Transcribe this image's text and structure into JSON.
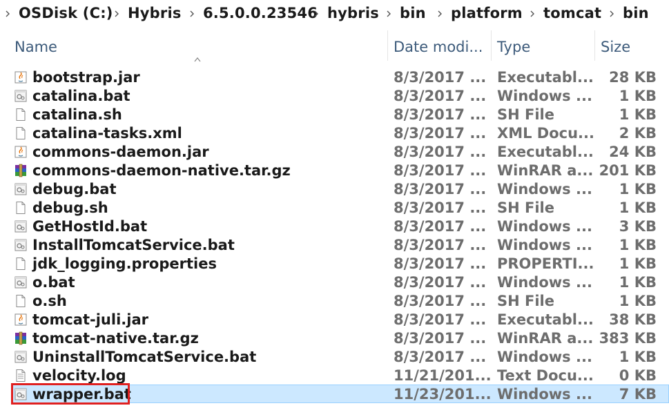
{
  "breadcrumb": [
    "OSDisk (C:)",
    "Hybris",
    "6.5.0.0.23546",
    "hybris",
    "bin",
    "platform",
    "tomcat",
    "bin"
  ],
  "columns": {
    "name": "Name",
    "date": "Date modi...",
    "type": "Type",
    "size": "Size"
  },
  "files": [
    {
      "name": "bootstrap.jar",
      "date": "8/3/2017 ...",
      "type": "Executabl...",
      "size": "28 KB",
      "icon": "jar-icon"
    },
    {
      "name": "catalina.bat",
      "date": "8/3/2017 ...",
      "type": "Windows ...",
      "size": "1 KB",
      "icon": "bat-icon"
    },
    {
      "name": "catalina.sh",
      "date": "8/3/2017 ...",
      "type": "SH File",
      "size": "1 KB",
      "icon": "file-icon"
    },
    {
      "name": "catalina-tasks.xml",
      "date": "8/3/2017 ...",
      "type": "XML Docu...",
      "size": "2 KB",
      "icon": "file-icon"
    },
    {
      "name": "commons-daemon.jar",
      "date": "8/3/2017 ...",
      "type": "Executabl...",
      "size": "24 KB",
      "icon": "jar-icon"
    },
    {
      "name": "commons-daemon-native.tar.gz",
      "date": "8/3/2017 ...",
      "type": "WinRAR a...",
      "size": "201 KB",
      "icon": "winrar-icon"
    },
    {
      "name": "debug.bat",
      "date": "8/3/2017 ...",
      "type": "Windows ...",
      "size": "1 KB",
      "icon": "bat-icon"
    },
    {
      "name": "debug.sh",
      "date": "8/3/2017 ...",
      "type": "SH File",
      "size": "1 KB",
      "icon": "file-icon"
    },
    {
      "name": "GetHostId.bat",
      "date": "8/3/2017 ...",
      "type": "Windows ...",
      "size": "3 KB",
      "icon": "bat-icon"
    },
    {
      "name": "InstallTomcatService.bat",
      "date": "8/3/2017 ...",
      "type": "Windows ...",
      "size": "1 KB",
      "icon": "bat-icon"
    },
    {
      "name": "jdk_logging.properties",
      "date": "8/3/2017 ...",
      "type": "PROPERTI...",
      "size": "1 KB",
      "icon": "file-icon"
    },
    {
      "name": "o.bat",
      "date": "8/3/2017 ...",
      "type": "Windows ...",
      "size": "1 KB",
      "icon": "bat-icon"
    },
    {
      "name": "o.sh",
      "date": "8/3/2017 ...",
      "type": "SH File",
      "size": "1 KB",
      "icon": "file-icon"
    },
    {
      "name": "tomcat-juli.jar",
      "date": "8/3/2017 ...",
      "type": "Executabl...",
      "size": "38 KB",
      "icon": "jar-icon"
    },
    {
      "name": "tomcat-native.tar.gz",
      "date": "8/3/2017 ...",
      "type": "WinRAR a...",
      "size": "383 KB",
      "icon": "winrar-icon"
    },
    {
      "name": "UninstallTomcatService.bat",
      "date": "8/3/2017 ...",
      "type": "Windows ...",
      "size": "1 KB",
      "icon": "bat-icon"
    },
    {
      "name": "velocity.log",
      "date": "11/21/201...",
      "type": "Text Docu...",
      "size": "0 KB",
      "icon": "text-file-icon"
    },
    {
      "name": "wrapper.bat",
      "date": "11/23/201...",
      "type": "Windows ...",
      "size": "7 KB",
      "icon": "bat-icon",
      "selected": true,
      "highlighted": true
    }
  ],
  "colors": {
    "selection_bg": "#cce8ff",
    "highlight_border": "#e02020",
    "header_text": "#3c5a7a"
  }
}
